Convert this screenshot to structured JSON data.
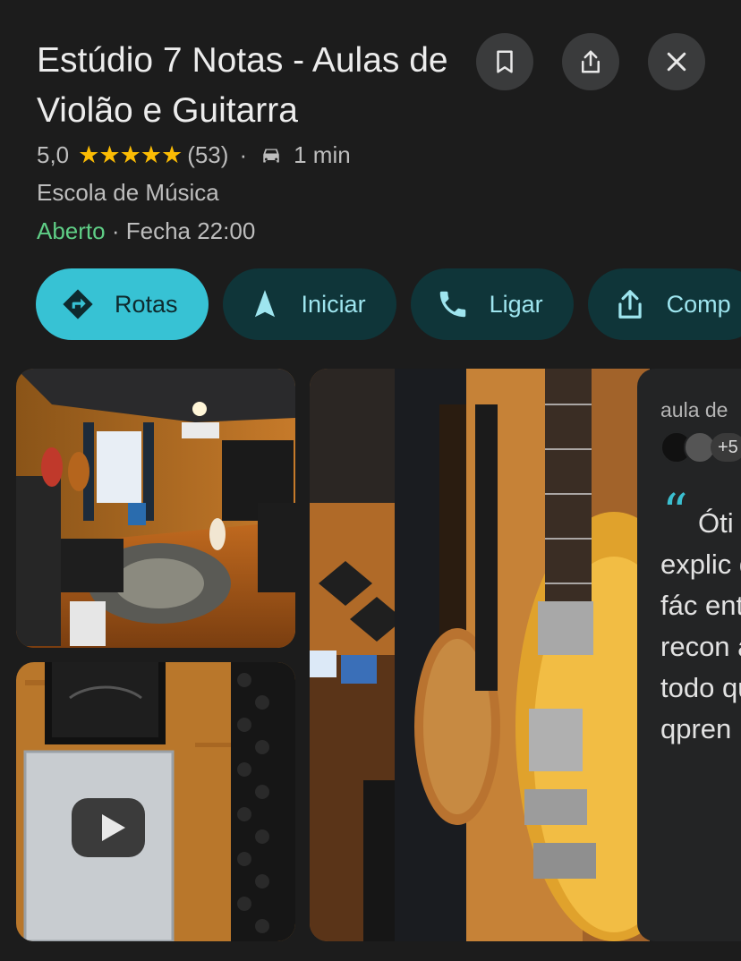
{
  "place": {
    "title": "Estúdio 7 Notas - Aulas de Violão e Guitarra",
    "rating": "5,0",
    "stars": "★★★★★",
    "review_count": "(53)",
    "separator": "·",
    "drive_time": "1 min",
    "category": "Escola de Música",
    "open_status": "Aberto",
    "hours": "· Fecha 22:00"
  },
  "header_buttons": {
    "save_icon": "bookmark-icon",
    "share_icon": "share-icon",
    "close_icon": "close-icon"
  },
  "actions": [
    {
      "label": "Rotas",
      "icon": "directions-icon"
    },
    {
      "label": "Iniciar",
      "icon": "navigation-arrow-icon"
    },
    {
      "label": "Ligar",
      "icon": "phone-icon"
    },
    {
      "label": "Comp",
      "icon": "share-icon"
    }
  ],
  "review": {
    "title": "aula de",
    "more_count": "+5",
    "text": "Óti méto explic de fác enten o recon a todo quere qpren"
  },
  "colors": {
    "background": "#1c1c1c",
    "accent": "#37c2d4",
    "open": "#5fce86",
    "stars": "#fbbc04"
  }
}
